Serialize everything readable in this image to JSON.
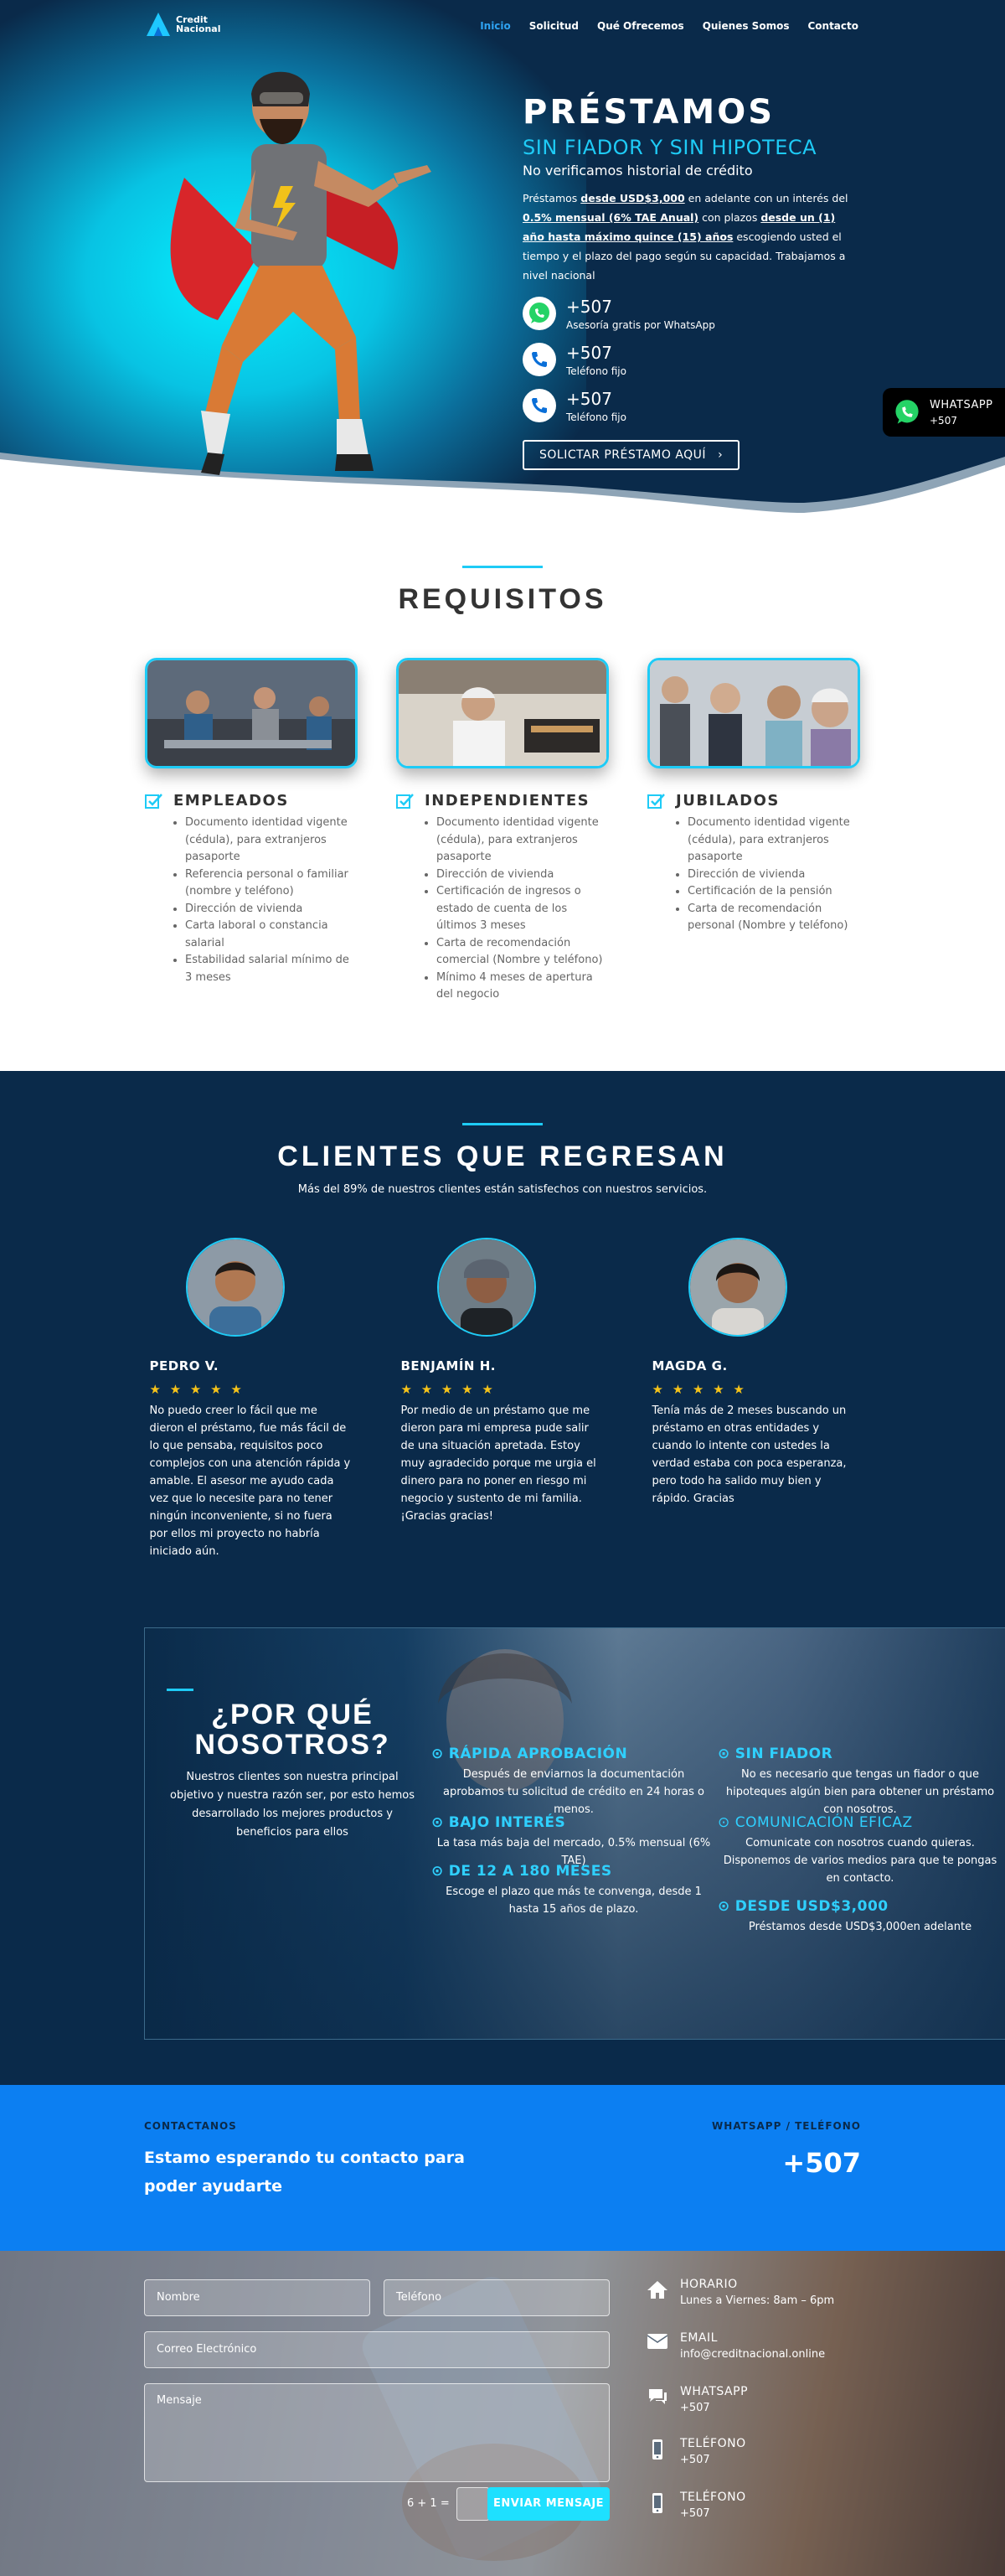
{
  "nav": {
    "brand_line1": "Credit",
    "brand_line2": "Nacional",
    "items": [
      "Inicio",
      "Solicitud",
      "Qué Ofrecemos",
      "Quienes Somos",
      "Contacto"
    ]
  },
  "hero": {
    "title": "PRÉSTAMOS",
    "subtitle": "SIN FIADOR Y SIN HIPOTECA",
    "note": "No verificamos historial de crédito",
    "desc_1": "Préstamos ",
    "desc_2": "desde USD$3,000",
    "desc_3": " en adelante con un interés del ",
    "desc_4": "0.5% mensual (6% TAE Anual)",
    "desc_5": " con plazos ",
    "desc_6": "desde un (1) año hasta máximo quince (15) años",
    "desc_7": " escogiendo usted el tiempo y el plazo del pago según su capacidad. Trabajamos a nivel nacional",
    "contacts": [
      {
        "number": "+507",
        "label": "Asesoría gratis por WhatsApp",
        "icon": "whatsapp-icon"
      },
      {
        "number": "+507",
        "label": "Teléfono fijo",
        "icon": "phone-icon"
      },
      {
        "number": "+507",
        "label": "Teléfono fijo",
        "icon": "phone-icon"
      }
    ],
    "cta": "SOLICTAR PRÉSTAMO AQUÍ",
    "colors": {
      "accent": "#1ecbf6",
      "dark": "#0a2a4a"
    }
  },
  "whatsapp_float": {
    "title": "WHATSAPP",
    "number": "+507"
  },
  "requisitos": {
    "title": "REQUISITOS",
    "columns": [
      {
        "heading": "EMPLEADOS",
        "items": [
          "Documento identidad vigente (cédula), para extranjeros pasaporte",
          "Referencia personal o familiar (nombre y teléfono)",
          "Dirección de vivienda",
          "Carta laboral o constancia salarial",
          "Estabilidad salarial mínimo de 3 meses"
        ]
      },
      {
        "heading": "INDEPENDIENTES",
        "items": [
          "Documento identidad vigente (cédula), para extranjeros pasaporte",
          "Dirección de vivienda",
          "Certificación de ingresos o estado de cuenta de los últimos 3 meses",
          "Carta de recomendación comercial (Nombre y teléfono)",
          "Mínimo 4 meses de apertura del negocio"
        ]
      },
      {
        "heading": "JUBILADOS",
        "items": [
          "Documento identidad vigente (cédula), para extranjeros pasaporte",
          "Dirección de vivienda",
          "Certificación de la pensión",
          "Carta de recomendación personal (Nombre y teléfono)"
        ]
      }
    ]
  },
  "clientes": {
    "title": "CLIENTES QUE REGRESAN",
    "subtitle": "Más del 89% de nuestros clientes están satisfechos con nuestros servicios.",
    "testimonials": [
      {
        "name": "PEDRO V.",
        "stars": "★ ★ ★ ★ ★",
        "text": "No puedo creer lo fácil que me dieron el préstamo, fue más fácil de lo que pensaba, requisitos poco complejos con una atención rápida y amable. El asesor me ayudo cada vez que lo necesite para no tener ningún inconveniente, si no fuera por ellos mi proyecto no habría iniciado aún."
      },
      {
        "name": "BENJAMÍN H.",
        "stars": "★ ★ ★ ★ ★",
        "text": "Por medio de un préstamo que me dieron para mi empresa pude salir de una situación apretada. Estoy muy agradecido porque me urgia el dinero para no poner en riesgo mi negocio y sustento de mi familia. ¡Gracias gracias!"
      },
      {
        "name": "MAGDA G.",
        "stars": "★ ★ ★ ★ ★",
        "text": "Tenía más de 2 meses buscando un préstamo en otras entidades y cuando lo intente con ustedes la verdad estaba con poca esperanza, pero todo ha salido muy bien y rápido. Gracias"
      }
    ]
  },
  "why": {
    "title": "¿POR QUÉ NOSOTROS?",
    "desc": "Nuestros clientes son nuestra principal objetivo y nuestra razón ser, por esto hemos desarrollado los mejores productos y beneficios para ellos",
    "features": [
      {
        "title": "RÁPIDA APROBACIÓN",
        "desc": "Después de enviarnos la documentación aprobamos tu solicitud de crédito en 24 horas o menos."
      },
      {
        "title": "BAJO INTERÉS",
        "desc": "La tasa más baja del mercado, 0.5% mensual (6% TAE)"
      },
      {
        "title": "DE 12 A 180 MESES",
        "desc": "Escoge el plazo que más te convenga, desde 1 hasta 15 años de plazo."
      },
      {
        "title": "SIN FIADOR",
        "desc": "No es necesario que tengas un fiador o que hipoteques algún bien para obtener un préstamo con nosotros."
      },
      {
        "title": "COMUNICACIÓN EFICAZ",
        "desc": "Comunicate con nosotros cuando quieras. Disponemos de varios medios para que te pongas en contacto."
      },
      {
        "title": "DESDE USD$3,000",
        "desc": "Préstamos desde USD$3,000en adelante"
      }
    ]
  },
  "contact_band": {
    "left_kicker": "CONTACTANOS",
    "left_text_1": "Estamo esperando tu contacto para",
    "left_text_2": "poder ayudarte",
    "right_kicker": "WHATSAPP / TELÉFONO",
    "right_number": "+507"
  },
  "form": {
    "name_placeholder": "Nombre",
    "phone_placeholder": "Teléfono",
    "email_placeholder": "Correo Electrónico",
    "message_placeholder": "Mensaje",
    "captcha": "6 + 1 =",
    "submit": "ENVIAR MENSAJE"
  },
  "contact_info": [
    {
      "title": "HORARIO",
      "detail": "Lunes a Viernes: 8am – 6pm",
      "icon": "home-icon"
    },
    {
      "title": "EMAIL",
      "detail": "info@creditnacional.online",
      "icon": "envelope-icon"
    },
    {
      "title": "WHATSAPP",
      "detail": "+507",
      "icon": "chat-icon"
    },
    {
      "title": "TELÉFONO",
      "detail": "+507",
      "icon": "mobile-icon"
    },
    {
      "title": "TELÉFONO",
      "detail": "+507",
      "icon": "mobile-icon"
    }
  ]
}
